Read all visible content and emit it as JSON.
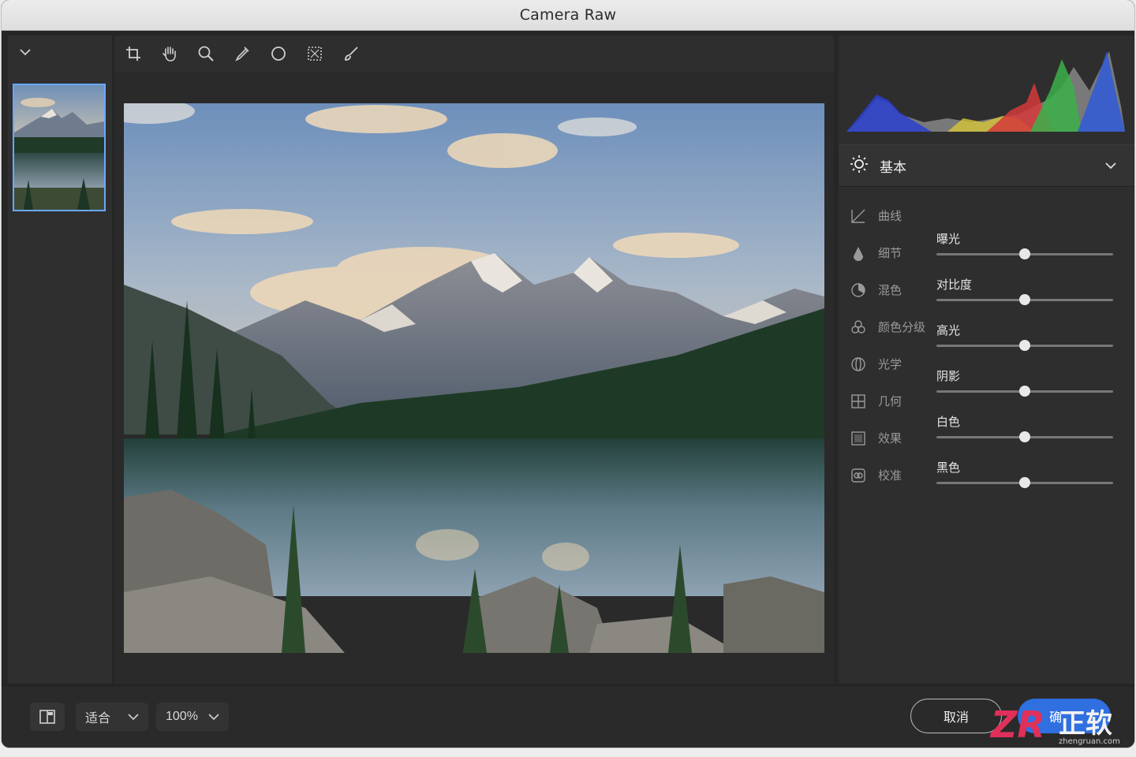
{
  "window": {
    "title": "Camera Raw"
  },
  "toolbar": {
    "tools": [
      "crop-icon",
      "hand-icon",
      "zoom-icon",
      "eyedropper-icon",
      "circle-mask-icon",
      "selection-icon",
      "brush-icon"
    ]
  },
  "basic_panel": {
    "label": "基本"
  },
  "panels": [
    {
      "label": "曲线",
      "icon": "curve-icon"
    },
    {
      "label": "细节",
      "icon": "detail-icon"
    },
    {
      "label": "混色",
      "icon": "mix-icon"
    },
    {
      "label": "颜色分级",
      "icon": "color-grading-icon"
    },
    {
      "label": "光学",
      "icon": "optics-icon"
    },
    {
      "label": "几何",
      "icon": "geometry-icon"
    },
    {
      "label": "效果",
      "icon": "effects-icon"
    },
    {
      "label": "校准",
      "icon": "calibration-icon"
    }
  ],
  "sliders": [
    {
      "label": "曝光",
      "position": 0.5
    },
    {
      "label": "对比度",
      "position": 0.5
    },
    {
      "label": "高光",
      "position": 0.5
    },
    {
      "label": "阴影",
      "position": 0.5
    },
    {
      "label": "白色",
      "position": 0.5
    },
    {
      "label": "黑色",
      "position": 0.5
    }
  ],
  "bottom": {
    "fit_label": "适合",
    "zoom_label": "100%",
    "cancel_label": "取消",
    "ok_label": "确"
  },
  "watermark": {
    "text": "正软",
    "domain": "zhengruan.com"
  },
  "colors": {
    "accent": "#2f6fe0",
    "panel": "#2e2e2e",
    "background": "#262626"
  }
}
